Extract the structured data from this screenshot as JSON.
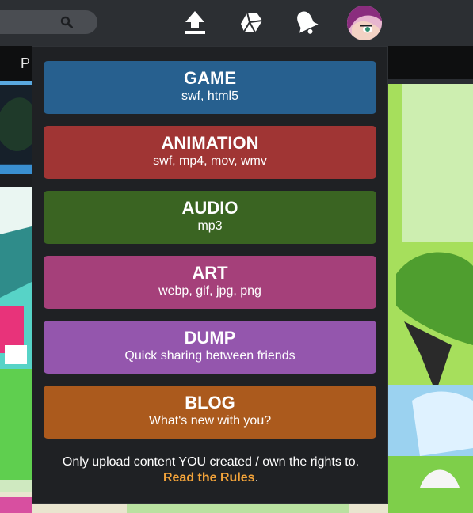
{
  "topbar": {
    "icons": [
      "search-icon",
      "upload-icon",
      "dumping-ground-icon",
      "notifications-bell-icon",
      "user-avatar"
    ]
  },
  "subnav": {
    "label": "P"
  },
  "upload_menu": {
    "categories": [
      {
        "title": "GAME",
        "subtitle": "swf, html5",
        "color": "#27608f"
      },
      {
        "title": "ANIMATION",
        "subtitle": "swf, mp4, mov, wmv",
        "color": "#a03534"
      },
      {
        "title": "AUDIO",
        "subtitle": "mp3",
        "color": "#3a6422"
      },
      {
        "title": "ART",
        "subtitle": "webp, gif, jpg, png",
        "color": "#a5407a"
      },
      {
        "title": "DUMP",
        "subtitle": "Quick sharing between friends",
        "color": "#9456ad"
      },
      {
        "title": "BLOG",
        "subtitle": "What's new with you?",
        "color": "#ab5a1d"
      }
    ],
    "footer_text": "Only upload content YOU created / own the rights to.",
    "rules_link": "Read the Rules",
    "rules_suffix": "."
  },
  "colors": {
    "topbar_bg": "#2c2f33",
    "dropdown_bg": "#1f2124",
    "link_accent": "#f2a33a"
  }
}
